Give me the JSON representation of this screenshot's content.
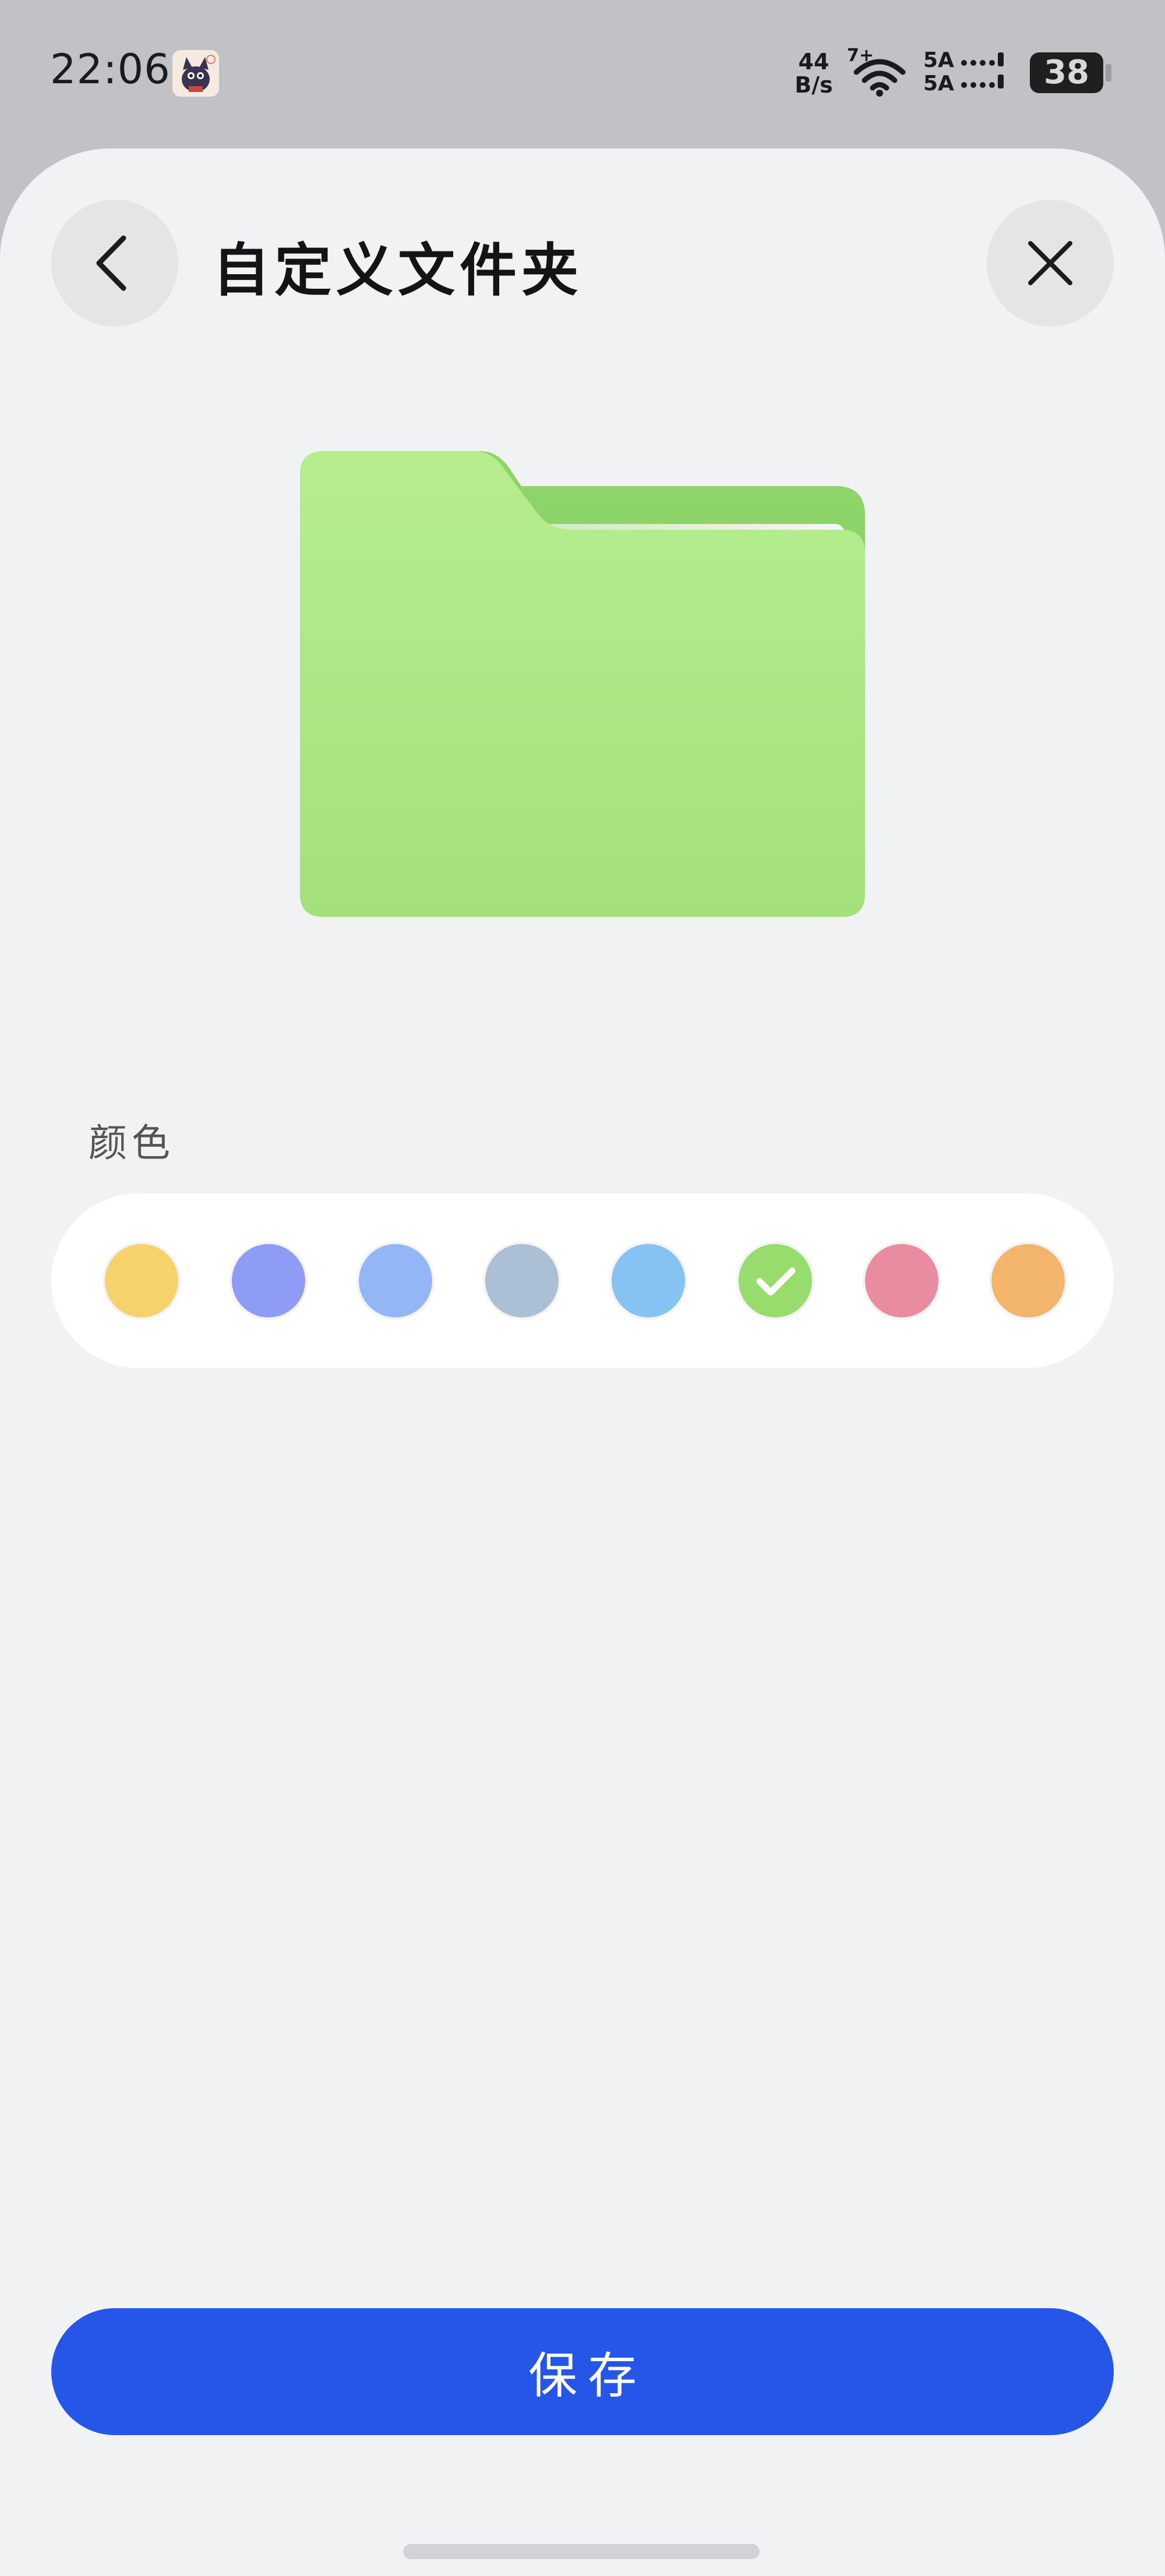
{
  "status_bar": {
    "time": "22:06",
    "net_speed_value": "44",
    "net_speed_unit": "B/s",
    "wifi_badge": "7+",
    "signal_top": "5A",
    "signal_bottom": "5A",
    "battery": "38"
  },
  "header": {
    "title": "自定义文件夹",
    "back_icon": "chevron-left-icon",
    "close_icon": "close-icon"
  },
  "folder_preview": {
    "color": "#a3e07b"
  },
  "color_section": {
    "label": "颜色",
    "swatches": [
      {
        "name": "yellow",
        "color": "#f5d26c",
        "selected": false
      },
      {
        "name": "purple",
        "color": "#8f9cf5",
        "selected": false
      },
      {
        "name": "light-blue",
        "color": "#93b6f6",
        "selected": false
      },
      {
        "name": "gray-blue",
        "color": "#abc0d4",
        "selected": false
      },
      {
        "name": "sky-blue",
        "color": "#86c2f2",
        "selected": false
      },
      {
        "name": "green",
        "color": "#99dc6e",
        "selected": true
      },
      {
        "name": "pink",
        "color": "#ea8ca0",
        "selected": false
      },
      {
        "name": "orange",
        "color": "#f3b56c",
        "selected": false
      }
    ]
  },
  "actions": {
    "save_label": "保存"
  },
  "colors": {
    "accent": "#2656e8",
    "sheet_background": "#f1f2f4"
  }
}
